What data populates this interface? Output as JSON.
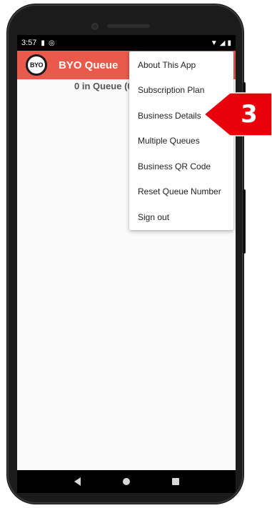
{
  "status_bar": {
    "time": "3:57",
    "icons_left": [
      "sd-card-icon",
      "at-icon"
    ],
    "icons_right": [
      "wifi-icon",
      "signal-icon",
      "battery-icon"
    ]
  },
  "app_bar": {
    "logo_text": "BYO",
    "title": "BYO Queue",
    "color": "#ea5a4c"
  },
  "queue": {
    "count_text": "0 in Queue (0"
  },
  "menu": {
    "items": [
      {
        "label": "About This App"
      },
      {
        "label": "Subscription Plan"
      },
      {
        "label": "Business Details"
      },
      {
        "label": "Multiple Queues"
      },
      {
        "label": "Business QR Code"
      },
      {
        "label": "Reset Queue Number"
      },
      {
        "label": "Sign out"
      }
    ]
  },
  "callout": {
    "number": "3",
    "color": "#e8000a"
  }
}
